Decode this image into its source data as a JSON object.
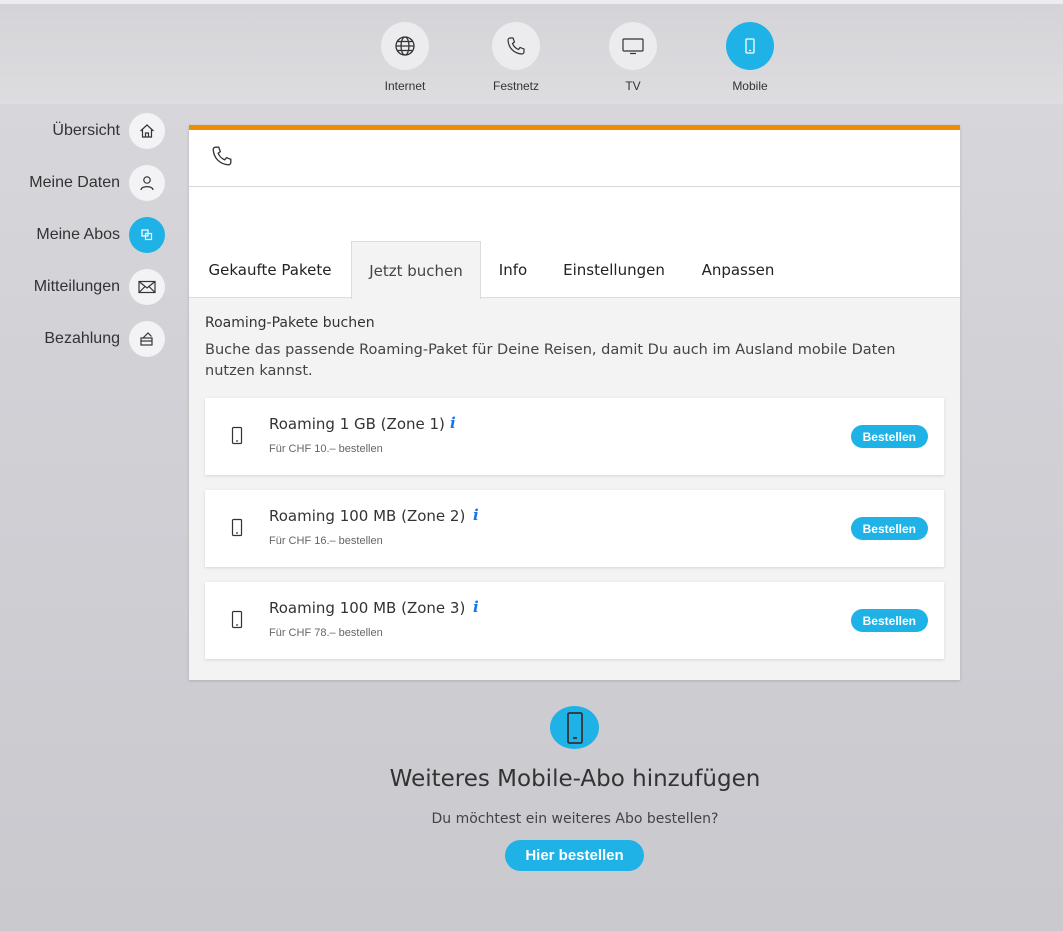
{
  "topnav": {
    "items": [
      {
        "label": "Internet",
        "icon": "globe-icon"
      },
      {
        "label": "Festnetz",
        "icon": "phone-icon"
      },
      {
        "label": "TV",
        "icon": "tv-icon"
      },
      {
        "label": "Mobile",
        "icon": "mobile-icon",
        "active": true
      }
    ]
  },
  "sidebar": {
    "items": [
      {
        "label": "Übersicht",
        "icon": "home-icon"
      },
      {
        "label": "Meine Daten",
        "icon": "user-icon"
      },
      {
        "label": "Meine Abos",
        "icon": "subscriptions-icon",
        "active": true
      },
      {
        "label": "Mitteilungen",
        "icon": "mail-icon"
      },
      {
        "label": "Bezahlung",
        "icon": "payment-icon"
      }
    ]
  },
  "card": {
    "accent_color": "#f08c00",
    "header_icon": "phone-icon",
    "tabs": [
      {
        "label": "Gekaufte Pakete"
      },
      {
        "label": "Jetzt buchen",
        "active": true
      },
      {
        "label": "Info"
      },
      {
        "label": "Einstellungen"
      },
      {
        "label": "Anpassen"
      }
    ],
    "section_title": "Roaming-Pakete buchen",
    "section_desc": "Buche das passende Roaming-Paket für Deine Reisen, damit Du auch im Ausland mobile Daten nutzen kannst.",
    "packages": [
      {
        "name": "Roaming 1 GB (Zone 1)",
        "info": "i",
        "price": "Für CHF 10.– bestellen",
        "button": "Bestellen"
      },
      {
        "name": "Roaming 100 MB (Zone 2)",
        "info": "i",
        "price": "Für CHF 16.– bestellen",
        "button": "Bestellen"
      },
      {
        "name": "Roaming 100 MB (Zone 3)",
        "info": "i",
        "price": "Für CHF 78.– bestellen",
        "button": "Bestellen"
      }
    ]
  },
  "add": {
    "icon": "mobile-icon",
    "title": "Weiteres Mobile-Abo hinzufügen",
    "desc": "Du möchtest ein weiteres Abo bestellen?",
    "button": "Hier bestellen"
  },
  "colors": {
    "accent": "#1eb2e6",
    "card_top": "#f08c00",
    "info": "#1a73e8"
  }
}
